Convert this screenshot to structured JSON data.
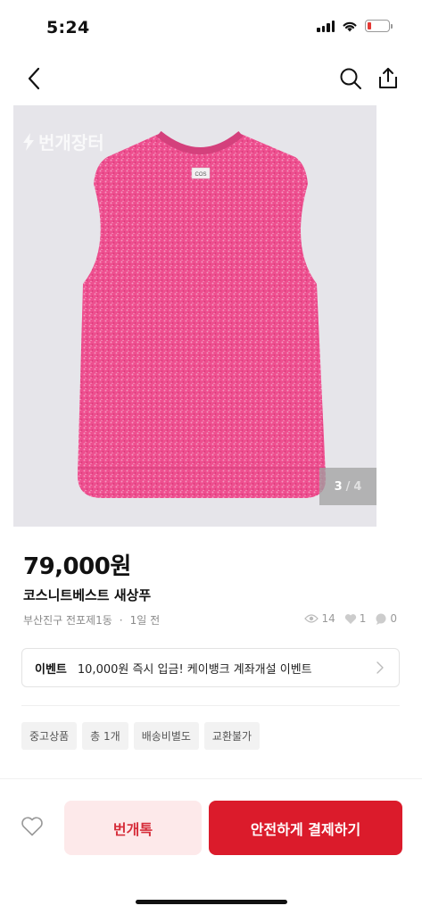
{
  "status_bar": {
    "time": "5:24"
  },
  "nav": {
    "back_icon": "chevron-left-icon",
    "search_icon": "search-icon",
    "share_icon": "share-icon"
  },
  "product": {
    "image": {
      "watermark": "번개장터",
      "current": "3",
      "separator": "/",
      "total": "4",
      "knit_color": "#ee4f8f",
      "knit_label": "COS"
    },
    "price": "79,000원",
    "title": "코스니트베스트 새상푸",
    "location": "부산진구 전포제1동",
    "time_ago": "1일 전",
    "stats": {
      "views": "14",
      "likes": "1",
      "chats": "0"
    }
  },
  "event": {
    "label": "이벤트",
    "text": "10,000원 즉시 입금! 케이뱅크 계좌개설 이벤트"
  },
  "tags": [
    "중고상품",
    "총 1개",
    "배송비별도",
    "교환불가"
  ],
  "actions": {
    "chat_label": "번개톡",
    "pay_label": "안전하게 결제하기",
    "accent_color": "#db1b2b"
  }
}
